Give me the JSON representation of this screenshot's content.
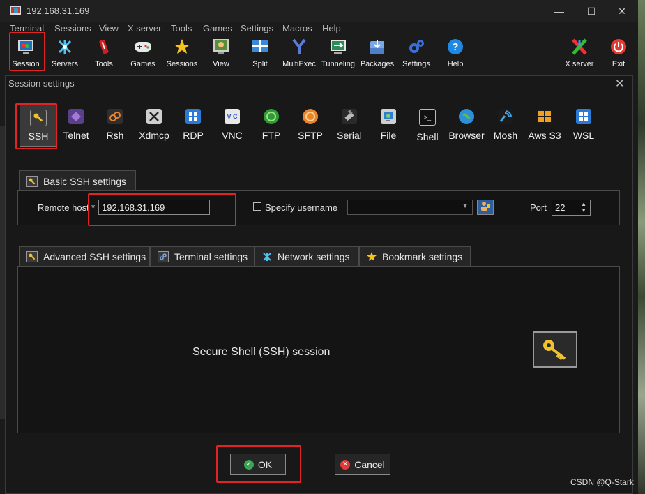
{
  "window": {
    "title": "192.168.31.169",
    "minimize": "—",
    "maximize": "☐",
    "close": "✕"
  },
  "menu": [
    "Terminal",
    "Sessions",
    "View",
    "X server",
    "Tools",
    "Games",
    "Settings",
    "Macros",
    "Help"
  ],
  "toolbar": [
    {
      "label": "Session",
      "icon": "session-icon"
    },
    {
      "label": "Servers",
      "icon": "servers-icon"
    },
    {
      "label": "Tools",
      "icon": "tools-icon"
    },
    {
      "label": "Games",
      "icon": "gamepad-icon"
    },
    {
      "label": "Sessions",
      "icon": "star-icon"
    },
    {
      "label": "View",
      "icon": "view-icon"
    },
    {
      "label": "Split",
      "icon": "split-icon"
    },
    {
      "label": "MultiExec",
      "icon": "multiexec-icon"
    },
    {
      "label": "Tunneling",
      "icon": "tunneling-icon"
    },
    {
      "label": "Packages",
      "icon": "packages-icon"
    },
    {
      "label": "Settings",
      "icon": "gear-icon"
    },
    {
      "label": "Help",
      "icon": "help-icon"
    }
  ],
  "toolbar_right": [
    {
      "label": "X server",
      "icon": "xserver-icon"
    },
    {
      "label": "Exit",
      "icon": "power-icon"
    }
  ],
  "dialog": {
    "title": "Session settings",
    "close": "✕",
    "protocols": [
      "SSH",
      "Telnet",
      "Rsh",
      "Xdmcp",
      "RDP",
      "VNC",
      "FTP",
      "SFTP",
      "Serial",
      "File",
      "Shell",
      "Browser",
      "Mosh",
      "Aws S3",
      "WSL"
    ],
    "basic_tab": "Basic SSH settings",
    "remote_host_label": "Remote host",
    "required_mark": "*",
    "remote_host_value": "192.168.31.169",
    "specify_username_label": "Specify username",
    "username_value": "",
    "port_label": "Port",
    "port_value": "22",
    "lower_tabs": [
      "Advanced SSH settings",
      "Terminal settings",
      "Network settings",
      "Bookmark settings"
    ],
    "description": "Secure Shell (SSH) session",
    "ok_label": "OK",
    "cancel_label": "Cancel"
  },
  "watermark": "CSDN @Q-Stark",
  "colors": {
    "highlight": "#e02424",
    "background": "#181818"
  }
}
